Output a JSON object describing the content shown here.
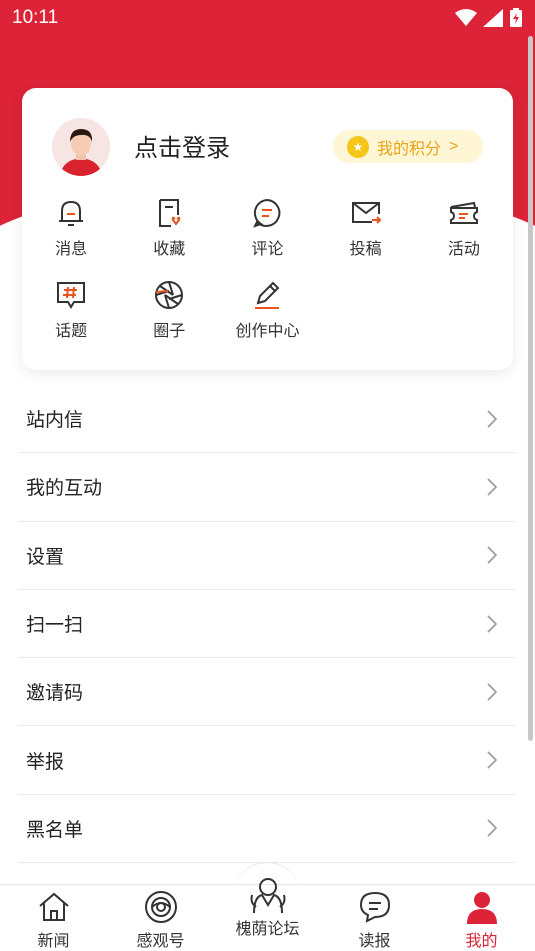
{
  "status_bar": {
    "time": "10:11"
  },
  "profile": {
    "login_text": "点击登录",
    "points_label": "我的积分",
    "points_arrow": ">"
  },
  "grid": [
    {
      "label": "消息",
      "icon": "bell-icon"
    },
    {
      "label": "收藏",
      "icon": "bookmark-heart-icon"
    },
    {
      "label": "评论",
      "icon": "comment-icon"
    },
    {
      "label": "投稿",
      "icon": "mail-send-icon"
    },
    {
      "label": "活动",
      "icon": "ticket-icon"
    },
    {
      "label": "话题",
      "icon": "hashtag-icon"
    },
    {
      "label": "圈子",
      "icon": "aperture-icon"
    },
    {
      "label": "创作中心",
      "icon": "pen-icon"
    }
  ],
  "menu": [
    {
      "label": "站内信"
    },
    {
      "label": "我的互动"
    },
    {
      "label": "设置"
    },
    {
      "label": "扫一扫"
    },
    {
      "label": "邀请码"
    },
    {
      "label": "举报"
    },
    {
      "label": "黑名单"
    }
  ],
  "tabs": [
    {
      "label": "新闻",
      "icon": "home-icon"
    },
    {
      "label": "感观号",
      "icon": "eye-circle-icon"
    },
    {
      "label": "槐荫论坛",
      "icon": "forum-icon"
    },
    {
      "label": "读报",
      "icon": "chat-bubble-icon"
    },
    {
      "label": "我的",
      "icon": "user-icon",
      "active": true
    }
  ],
  "colors": {
    "brand_red": "#dc2338",
    "accent_orange": "#e8541e",
    "points_gold": "#e8a317"
  }
}
